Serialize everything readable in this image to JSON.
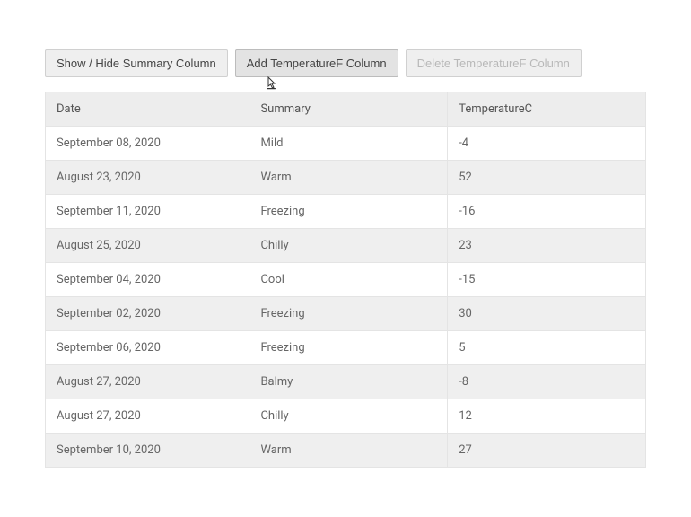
{
  "toolbar": {
    "toggle_summary_label": "Show / Hide Summary Column",
    "add_tempf_label": "Add TemperatureF Column",
    "delete_tempf_label": "Delete TemperatureF Column"
  },
  "table": {
    "headers": {
      "date": "Date",
      "summary": "Summary",
      "tempc": "TemperatureC"
    },
    "rows": [
      {
        "date": "September 08, 2020",
        "summary": "Mild",
        "tempc": "-4"
      },
      {
        "date": "August 23, 2020",
        "summary": "Warm",
        "tempc": "52"
      },
      {
        "date": "September 11, 2020",
        "summary": "Freezing",
        "tempc": "-16"
      },
      {
        "date": "August 25, 2020",
        "summary": "Chilly",
        "tempc": "23"
      },
      {
        "date": "September 04, 2020",
        "summary": "Cool",
        "tempc": "-15"
      },
      {
        "date": "September 02, 2020",
        "summary": "Freezing",
        "tempc": "30"
      },
      {
        "date": "September 06, 2020",
        "summary": "Freezing",
        "tempc": "5"
      },
      {
        "date": "August 27, 2020",
        "summary": "Balmy",
        "tempc": "-8"
      },
      {
        "date": "August 27, 2020",
        "summary": "Chilly",
        "tempc": "12"
      },
      {
        "date": "September 10, 2020",
        "summary": "Warm",
        "tempc": "27"
      }
    ]
  }
}
